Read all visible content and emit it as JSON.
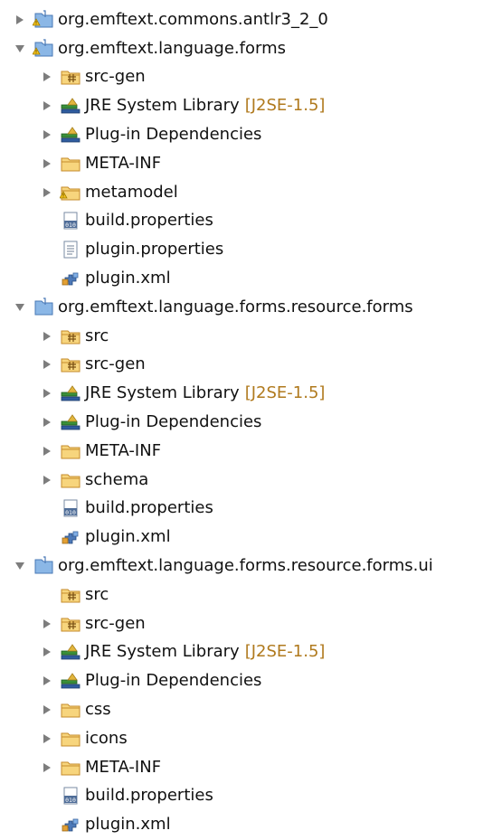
{
  "tree": [
    {
      "level": 0,
      "twisty": "collapsed",
      "icon": "project-warning-icon",
      "label": "org.emftext.commons.antlr3_2_0"
    },
    {
      "level": 0,
      "twisty": "expanded",
      "icon": "project-warning-icon",
      "label": "org.emftext.language.forms"
    },
    {
      "level": 1,
      "twisty": "collapsed",
      "icon": "package-folder-icon",
      "label": "src-gen"
    },
    {
      "level": 1,
      "twisty": "collapsed",
      "icon": "library-icon",
      "label": "JRE System Library",
      "decoration": "[J2SE-1.5]"
    },
    {
      "level": 1,
      "twisty": "collapsed",
      "icon": "library-icon",
      "label": "Plug-in Dependencies"
    },
    {
      "level": 1,
      "twisty": "collapsed",
      "icon": "folder-icon",
      "label": "META-INF"
    },
    {
      "level": 1,
      "twisty": "collapsed",
      "icon": "folder-warning-icon",
      "label": "metamodel"
    },
    {
      "level": 1,
      "twisty": "none",
      "icon": "binary-file-icon",
      "label": "build.properties"
    },
    {
      "level": 1,
      "twisty": "none",
      "icon": "text-file-icon",
      "label": "plugin.properties"
    },
    {
      "level": 1,
      "twisty": "none",
      "icon": "plugin-xml-icon",
      "label": "plugin.xml"
    },
    {
      "level": 0,
      "twisty": "expanded",
      "icon": "project-icon",
      "label": "org.emftext.language.forms.resource.forms"
    },
    {
      "level": 1,
      "twisty": "collapsed",
      "icon": "package-folder-icon",
      "label": "src"
    },
    {
      "level": 1,
      "twisty": "collapsed",
      "icon": "package-folder-icon",
      "label": "src-gen"
    },
    {
      "level": 1,
      "twisty": "collapsed",
      "icon": "library-icon",
      "label": "JRE System Library",
      "decoration": "[J2SE-1.5]"
    },
    {
      "level": 1,
      "twisty": "collapsed",
      "icon": "library-icon",
      "label": "Plug-in Dependencies"
    },
    {
      "level": 1,
      "twisty": "collapsed",
      "icon": "folder-icon",
      "label": "META-INF"
    },
    {
      "level": 1,
      "twisty": "collapsed",
      "icon": "folder-icon",
      "label": "schema"
    },
    {
      "level": 1,
      "twisty": "none",
      "icon": "binary-file-icon",
      "label": "build.properties"
    },
    {
      "level": 1,
      "twisty": "none",
      "icon": "plugin-xml-icon",
      "label": "plugin.xml"
    },
    {
      "level": 0,
      "twisty": "expanded",
      "icon": "project-icon",
      "label": "org.emftext.language.forms.resource.forms.ui"
    },
    {
      "level": 1,
      "twisty": "none",
      "icon": "package-folder-icon",
      "label": "src"
    },
    {
      "level": 1,
      "twisty": "collapsed",
      "icon": "package-folder-icon",
      "label": "src-gen"
    },
    {
      "level": 1,
      "twisty": "collapsed",
      "icon": "library-icon",
      "label": "JRE System Library",
      "decoration": "[J2SE-1.5]"
    },
    {
      "level": 1,
      "twisty": "collapsed",
      "icon": "library-icon",
      "label": "Plug-in Dependencies"
    },
    {
      "level": 1,
      "twisty": "collapsed",
      "icon": "folder-icon",
      "label": "css"
    },
    {
      "level": 1,
      "twisty": "collapsed",
      "icon": "folder-icon",
      "label": "icons"
    },
    {
      "level": 1,
      "twisty": "collapsed",
      "icon": "folder-icon",
      "label": "META-INF"
    },
    {
      "level": 1,
      "twisty": "none",
      "icon": "binary-file-icon",
      "label": "build.properties"
    },
    {
      "level": 1,
      "twisty": "none",
      "icon": "plugin-xml-icon",
      "label": "plugin.xml"
    }
  ],
  "colors": {
    "text": "#111111",
    "decoration": "#b07a1e",
    "twisty": "#7d7d7d",
    "folder_fill": "#f7d57d",
    "folder_stroke": "#c58b2b",
    "project_fill": "#8bb7e6",
    "project_stroke": "#4a79b6",
    "warning": "#f2c21b"
  }
}
